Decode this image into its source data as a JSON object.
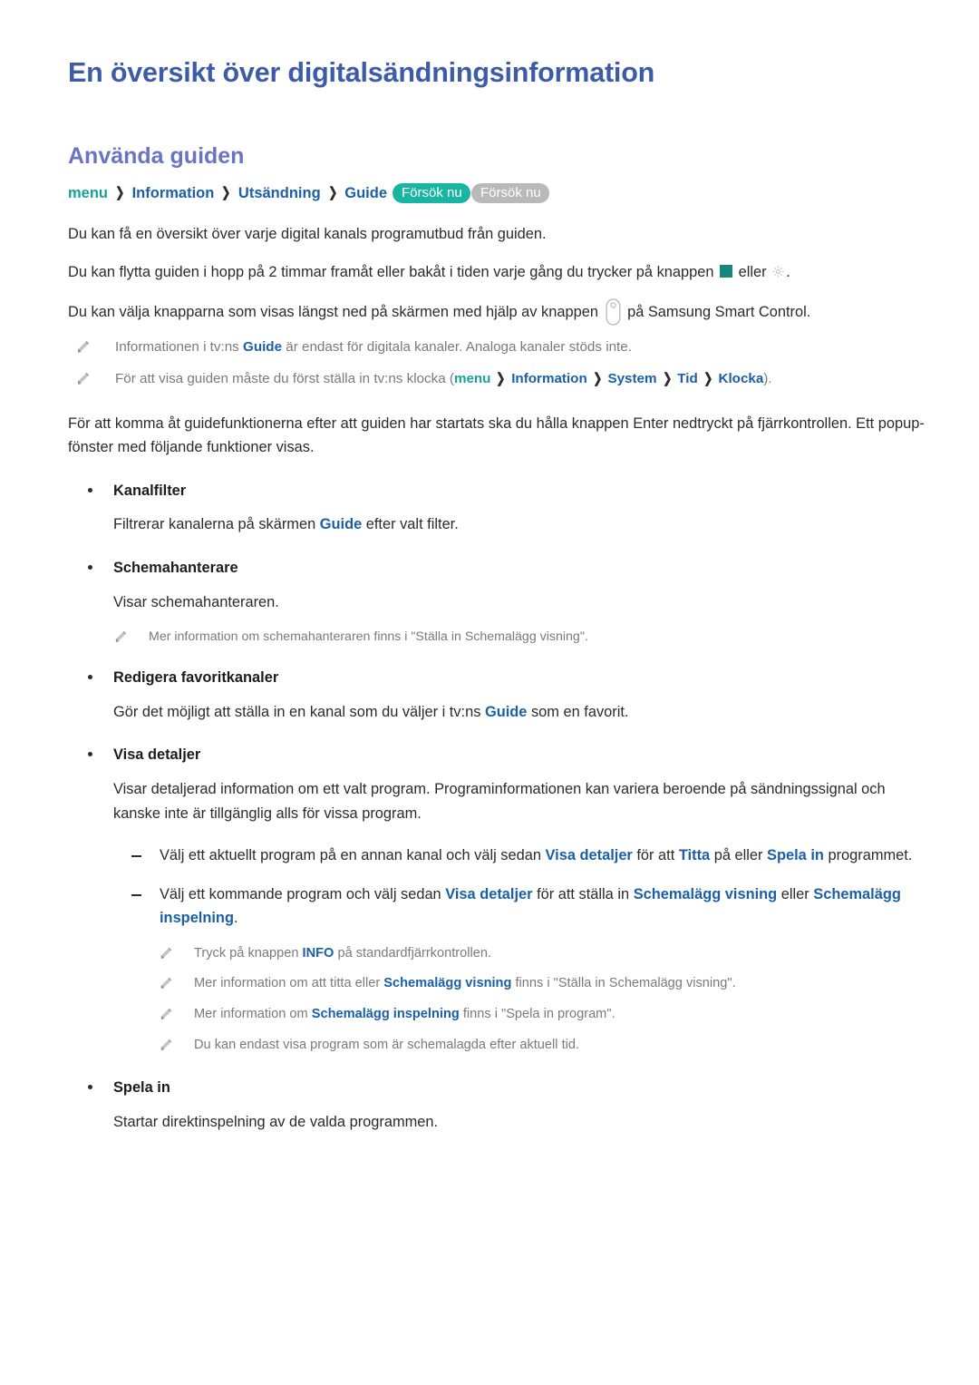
{
  "document": {
    "title": "En översikt över digitalsändningsinformation",
    "section_title": "Använda guiden"
  },
  "colors": {
    "doc_title": "#3c5ca8",
    "section_title": "#6b73c4",
    "link_blue": "#1a5fa8",
    "menu_teal": "#15a398",
    "pill_teal": "#19b5a3",
    "pill_gray": "#b9b9b9",
    "note_gray": "#7a7a7a",
    "body_text": "#2b2b2b",
    "square_icon": "#17867f"
  },
  "breadcrumb": {
    "items": [
      {
        "label": "menu",
        "style": "teal"
      },
      {
        "label": "Information",
        "style": "blue"
      },
      {
        "label": "Utsändning",
        "style": "blue"
      },
      {
        "label": "Guide",
        "style": "blue"
      }
    ],
    "separator": "❯",
    "pills": [
      {
        "label": "Försök nu",
        "style": "teal"
      },
      {
        "label": "Försök nu",
        "style": "gray"
      }
    ]
  },
  "intro": {
    "p1": "Du kan få en översikt över varje digital kanals programutbud från guiden.",
    "p2_a": "Du kan flytta guiden i hopp på 2 timmar framåt eller bakåt i tiden varje gång du trycker på knappen",
    "p2_b": "eller",
    "p2_c": ".",
    "p3_a": "Du kan välja knapparna som visas längst ned på skärmen med hjälp av knappen",
    "p3_b": "på Samsung Smart Control."
  },
  "icons": {
    "square": "teal-square-icon",
    "gear": "gear-icon",
    "remote_button": "remote-button-icon",
    "pencil": "pencil-icon"
  },
  "notes_top": [
    {
      "a": "Informationen i tv:ns",
      "bold": "Guide",
      "b": "är endast för digitala kanaler. Analoga kanaler stöds inte."
    }
  ],
  "note_clock": {
    "a": "För att visa guiden måste du först ställa in tv:ns klocka (",
    "menu": "menu",
    "items": [
      "Information",
      "System",
      "Tid",
      "Klocka"
    ],
    "b": ")."
  },
  "paragraph_access": "För att komma åt guidefunktionerna efter att guiden har startats ska du hålla knappen Enter nedtryckt på fjärrkontrollen. Ett popup-fönster med följande funktioner visas.",
  "features": [
    {
      "label": "Kanalfilter",
      "body_a": "Filtrerar kanalerna på skärmen",
      "body_bold": "Guide",
      "body_b": "efter valt filter."
    },
    {
      "label": "Schemahanterare",
      "body_a": "Visar schemahanteraren.",
      "note": "Mer information om schemahanteraren finns i \"Ställa in Schemalägg visning\"."
    },
    {
      "label": "Redigera favoritkanaler",
      "body_a": "Gör det möjligt att ställa in en kanal som du väljer i tv:ns",
      "body_bold": "Guide",
      "body_b": "som en favorit."
    },
    {
      "label": "Visa detaljer",
      "body_a": "Visar detaljerad information om ett valt program. Programinformationen kan variera beroende på sändningssignal och kanske inte är tillgänglig alls för vissa program."
    },
    {
      "label": "Spela in",
      "body_a": "Startar direktinspelning av de valda programmen."
    }
  ],
  "detail_dashes": [
    {
      "t1": "Välj ett aktuellt program på en annan kanal och välj sedan",
      "b1": "Visa detaljer",
      "t2": "för att",
      "b2": "Titta",
      "t3": "på eller",
      "b3": "Spela in",
      "t4": "programmet."
    },
    {
      "t1": "Välj ett kommande program och välj sedan",
      "b1": "Visa detaljer",
      "t2": "för att ställa in",
      "b2": "Schemalägg visning",
      "t3": "eller",
      "b3": "Schemalägg inspelning",
      "t4": "."
    }
  ],
  "detail_notes": [
    {
      "a": "Tryck på knappen",
      "bold": "INFO",
      "b": "på standardfjärrkontrollen."
    },
    {
      "a": "Mer information om att titta eller",
      "bold": "Schemalägg visning",
      "b": "finns i \"Ställa in Schemalägg visning\"."
    },
    {
      "a": "Mer information om",
      "bold": "Schemalägg inspelning",
      "b": "finns i \"Spela in program\"."
    },
    {
      "a": "Du kan endast visa program som är schemalagda efter aktuell tid.",
      "bold": "",
      "b": ""
    }
  ]
}
